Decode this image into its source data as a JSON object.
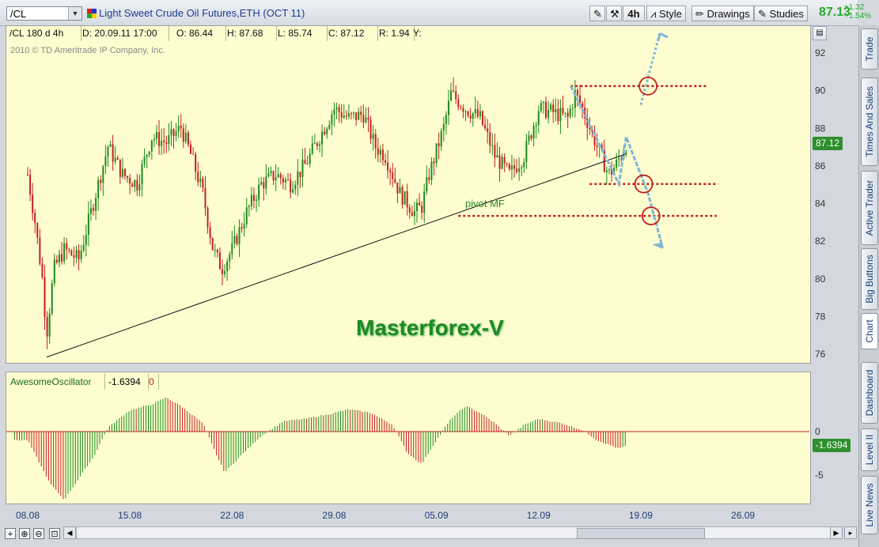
{
  "toolbar": {
    "symbol": "/CL",
    "title": "Light Sweet Crude Oil Futures,ETH (OCT 11)",
    "period_label": "4h",
    "style_label": "Style",
    "drawings_label": "Drawings",
    "studies_label": "Studies",
    "last_price": "87.13",
    "change": "+1.32",
    "change_pct": "+1.54%"
  },
  "side_tabs": [
    "Trade",
    "Times And Sales",
    "Active Trader",
    "Big Buttons",
    "Chart",
    "Dashboard",
    "Level II",
    "Live News"
  ],
  "info": {
    "symbol": "/CL 180 d 4h",
    "date": "D: 20.09.11 17:00",
    "open": "O: 86.44",
    "high": "H: 87.68",
    "low": "L: 85.74",
    "close": "C: 87.12",
    "range": "R: 1.94",
    "y": "Y:"
  },
  "copyright": "2010 © TD Ameritrade IP Company, Inc.",
  "watermark": "Masterforex-V",
  "pivot_label": "pivot MF",
  "price_badge": "87.12",
  "oscillator": {
    "name": "AwesomeOscillator",
    "value": "-1.6394",
    "extra": "0",
    "badge": "-1.6394"
  },
  "colors": {
    "up": "#1e8a1e",
    "down": "#c81e1e",
    "level": "#c41e1e",
    "arrow": "#7fb6d6",
    "background": "#fdfdd0"
  },
  "chart_data": [
    {
      "type": "candlestick",
      "title": "Light Sweet Crude Oil Futures,ETH (OCT 11)",
      "ylim": [
        75,
        93
      ],
      "y_ticks": [
        "92",
        "90",
        "88",
        "86",
        "84",
        "82",
        "80",
        "78",
        "76"
      ],
      "x_ticks": [
        "08.08",
        "15.08",
        "22.08",
        "29.08",
        "05.09",
        "12.09",
        "19.09",
        "26.09"
      ],
      "bars_per_day": 6,
      "close_path": [
        {
          "day": 0.0,
          "price": 85.5
        },
        {
          "day": 0.5,
          "price": 83.0
        },
        {
          "day": 1.0,
          "price": 80.0
        },
        {
          "day": 1.3,
          "price": 77.0
        },
        {
          "day": 1.8,
          "price": 80.5
        },
        {
          "day": 2.5,
          "price": 81.5
        },
        {
          "day": 3.5,
          "price": 81.0
        },
        {
          "day": 4.5,
          "price": 84.0
        },
        {
          "day": 5.5,
          "price": 87.0
        },
        {
          "day": 6.5,
          "price": 85.5
        },
        {
          "day": 7.5,
          "price": 85.0
        },
        {
          "day": 8.5,
          "price": 87.5
        },
        {
          "day": 9.5,
          "price": 87.2
        },
        {
          "day": 10.5,
          "price": 88.0
        },
        {
          "day": 11.2,
          "price": 86.5
        },
        {
          "day": 12.0,
          "price": 84.5
        },
        {
          "day": 12.7,
          "price": 81.5
        },
        {
          "day": 13.3,
          "price": 80.5
        },
        {
          "day": 14.0,
          "price": 81.5
        },
        {
          "day": 15.0,
          "price": 83.5
        },
        {
          "day": 16.0,
          "price": 85.0
        },
        {
          "day": 17.0,
          "price": 85.5
        },
        {
          "day": 18.0,
          "price": 85.0
        },
        {
          "day": 19.0,
          "price": 86.0
        },
        {
          "day": 20.0,
          "price": 87.5
        },
        {
          "day": 21.0,
          "price": 89.0
        },
        {
          "day": 22.0,
          "price": 88.5
        },
        {
          "day": 23.0,
          "price": 88.7
        },
        {
          "day": 23.8,
          "price": 87.0
        },
        {
          "day": 24.5,
          "price": 86.5
        },
        {
          "day": 25.5,
          "price": 84.5
        },
        {
          "day": 26.5,
          "price": 83.5
        },
        {
          "day": 27.0,
          "price": 83.8
        },
        {
          "day": 27.5,
          "price": 85.5
        },
        {
          "day": 28.5,
          "price": 88.0
        },
        {
          "day": 29.0,
          "price": 89.8
        },
        {
          "day": 30.0,
          "price": 89.0
        },
        {
          "day": 31.0,
          "price": 88.5
        },
        {
          "day": 32.0,
          "price": 86.5
        },
        {
          "day": 33.0,
          "price": 85.5
        },
        {
          "day": 34.0,
          "price": 86.5
        },
        {
          "day": 35.0,
          "price": 89.0
        },
        {
          "day": 36.0,
          "price": 88.8
        },
        {
          "day": 37.0,
          "price": 88.5
        },
        {
          "day": 37.5,
          "price": 89.8
        },
        {
          "day": 38.0,
          "price": 89.0
        },
        {
          "day": 38.5,
          "price": 88.0
        },
        {
          "day": 39.0,
          "price": 87.0
        },
        {
          "day": 39.8,
          "price": 85.5
        },
        {
          "day": 40.3,
          "price": 86.0
        },
        {
          "day": 41.0,
          "price": 87.1
        }
      ],
      "trendline": [
        {
          "day": 1.3,
          "price": 75.8
        },
        {
          "day": 41.0,
          "price": 86.6
        }
      ],
      "levels": [
        90.2,
        85.0,
        83.3
      ],
      "projection": [
        {
          "day": 37.2,
          "price": 90.2
        },
        {
          "day": 40.5,
          "price": 85.0
        },
        {
          "day": 41.0,
          "price": 87.5
        },
        {
          "day": 42.5,
          "price": 84.5
        },
        {
          "day": 43.5,
          "price": 81.6
        }
      ],
      "projection_up": [
        {
          "day": 42.0,
          "price": 89.2
        },
        {
          "day": 43.3,
          "price": 93.0
        }
      ],
      "circles": [
        {
          "day": 42.5,
          "price": 90.2
        },
        {
          "day": 42.2,
          "price": 85.0
        },
        {
          "day": 42.7,
          "price": 83.3
        }
      ]
    },
    {
      "type": "bar",
      "title": "AwesomeOscillator",
      "ylim": [
        -9,
        6
      ],
      "y_ticks": [
        "0",
        "-5"
      ],
      "path": [
        {
          "day": 0.0,
          "value": -1.0
        },
        {
          "day": 1.5,
          "value": -6.0
        },
        {
          "day": 2.5,
          "value": -8.0
        },
        {
          "day": 4.5,
          "value": -3.0
        },
        {
          "day": 5.5,
          "value": 0.5
        },
        {
          "day": 7.0,
          "value": 2.5
        },
        {
          "day": 8.5,
          "value": 3.2
        },
        {
          "day": 9.5,
          "value": 4.0
        },
        {
          "day": 10.5,
          "value": 3.0
        },
        {
          "day": 12.0,
          "value": 1.0
        },
        {
          "day": 13.0,
          "value": -3.0
        },
        {
          "day": 13.5,
          "value": -4.8
        },
        {
          "day": 14.5,
          "value": -3.0
        },
        {
          "day": 16.0,
          "value": -0.5
        },
        {
          "day": 17.5,
          "value": 1.2
        },
        {
          "day": 19.0,
          "value": 1.5
        },
        {
          "day": 20.5,
          "value": 2.0
        },
        {
          "day": 22.0,
          "value": 2.6
        },
        {
          "day": 23.5,
          "value": 2.2
        },
        {
          "day": 25.0,
          "value": 0.8
        },
        {
          "day": 26.0,
          "value": -2.5
        },
        {
          "day": 27.0,
          "value": -3.8
        },
        {
          "day": 28.0,
          "value": -1.0
        },
        {
          "day": 29.0,
          "value": 1.5
        },
        {
          "day": 30.0,
          "value": 3.0
        },
        {
          "day": 31.0,
          "value": 2.2
        },
        {
          "day": 32.0,
          "value": 1.0
        },
        {
          "day": 33.0,
          "value": -0.5
        },
        {
          "day": 34.0,
          "value": 0.8
        },
        {
          "day": 35.0,
          "value": 1.5
        },
        {
          "day": 36.5,
          "value": 1.0
        },
        {
          "day": 38.0,
          "value": 0.2
        },
        {
          "day": 39.0,
          "value": -1.0
        },
        {
          "day": 40.5,
          "value": -2.0
        },
        {
          "day": 41.0,
          "value": -1.64
        }
      ]
    }
  ]
}
